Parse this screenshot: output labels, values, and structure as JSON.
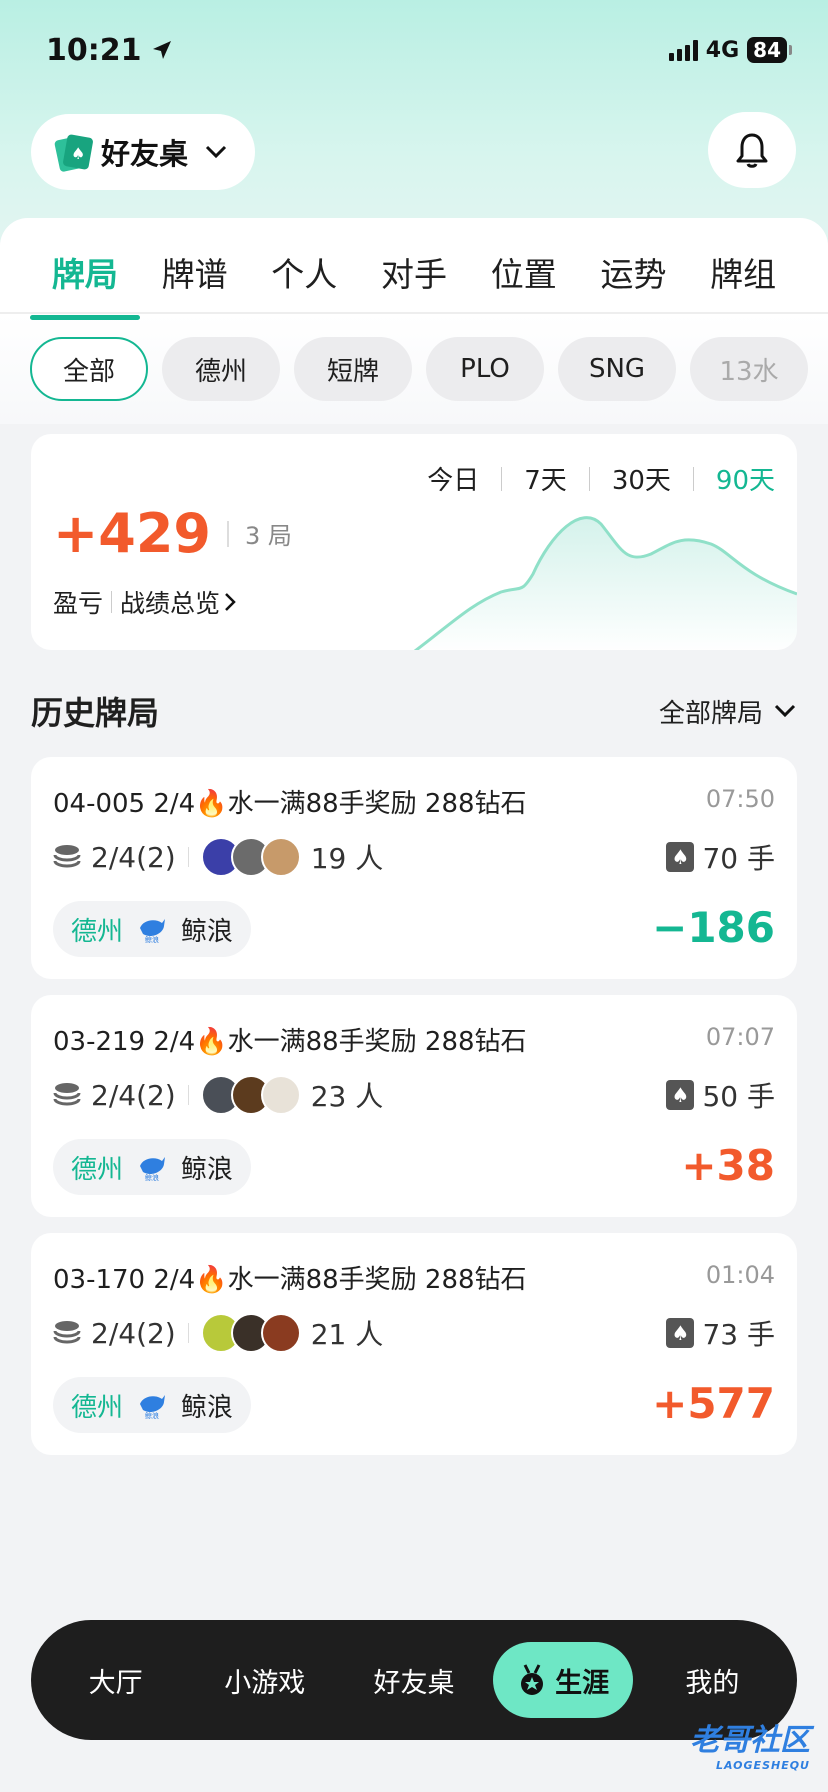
{
  "status_bar": {
    "time": "10:21",
    "network": "4G",
    "battery": "84"
  },
  "header": {
    "friend_table": "好友桌"
  },
  "tabs": [
    {
      "label": "牌局",
      "active": true
    },
    {
      "label": "牌谱"
    },
    {
      "label": "个人"
    },
    {
      "label": "对手"
    },
    {
      "label": "位置"
    },
    {
      "label": "运势"
    },
    {
      "label": "牌组"
    }
  ],
  "filters": [
    "全部",
    "德州",
    "短牌",
    "PLO",
    "SNG",
    "13水"
  ],
  "summary": {
    "periods": [
      "今日",
      "7天",
      "30天",
      "90天"
    ],
    "active_period": "90天",
    "profit": "+429",
    "games": "3 局",
    "link_profit": "盈亏",
    "link_overview": "战绩总览",
    "trend_color": "#14b792"
  },
  "history": {
    "title": "历史牌局",
    "filter": "全部牌局",
    "games": [
      {
        "name": "04-005 2/4🔥水一满88手奖励 288钻石",
        "time": "07:50",
        "blinds": "2/4(2)",
        "players": "19 人",
        "hands": "70 手",
        "type": "德州",
        "club": "鲸浪",
        "result": "−186",
        "sign": "neg",
        "avatars": [
          "#3b3fa8",
          "#6b6b6b",
          "#c79a6a"
        ]
      },
      {
        "name": "03-219 2/4🔥水一满88手奖励 288钻石",
        "time": "07:07",
        "blinds": "2/4(2)",
        "players": "23 人",
        "hands": "50 手",
        "type": "德州",
        "club": "鲸浪",
        "result": "+38",
        "sign": "pos",
        "avatars": [
          "#4a4f57",
          "#5c3b1e",
          "#e8e2d8"
        ]
      },
      {
        "name": "03-170 2/4🔥水一满88手奖励 288钻石",
        "time": "01:04",
        "blinds": "2/4(2)",
        "players": "21 人",
        "hands": "73 手",
        "type": "德州",
        "club": "鲸浪",
        "result": "+577",
        "sign": "pos",
        "avatars": [
          "#b8c93a",
          "#3a3028",
          "#8a3b20"
        ]
      }
    ]
  },
  "bottom_nav": [
    "大厅",
    "小游戏",
    "好友桌",
    "生涯",
    "我的"
  ],
  "bottom_nav_active": "生涯",
  "watermark": {
    "text": "老哥社区",
    "sub": "LAOGESHEQU"
  },
  "colors": {
    "accent": "#14b792",
    "loss": "#14b792",
    "gain": "#f25a2c"
  }
}
